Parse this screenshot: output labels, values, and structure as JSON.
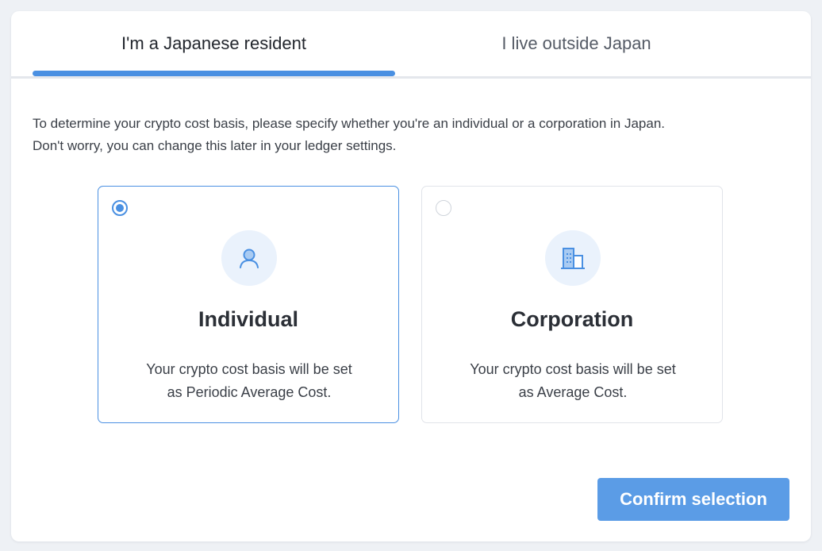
{
  "tabs": [
    {
      "label": "I'm a Japanese resident",
      "active": true
    },
    {
      "label": "I live outside Japan",
      "active": false
    }
  ],
  "intro": {
    "line1": "To determine your crypto cost basis, please specify whether you're an individual or a corporation in Japan.",
    "line2": "Don't worry, you can change this later in your ledger settings."
  },
  "options": [
    {
      "title": "Individual",
      "desc_line1": "Your crypto cost basis will be set",
      "desc_line2": "as Periodic Average Cost.",
      "selected": true,
      "icon": "person-icon"
    },
    {
      "title": "Corporation",
      "desc_line1": "Your crypto cost basis will be set",
      "desc_line2": "as Average Cost.",
      "selected": false,
      "icon": "building-icon"
    }
  ],
  "confirm_label": "Confirm selection",
  "colors": {
    "accent": "#4a90e2",
    "button": "#5b9ce6",
    "icon_bg": "#eaf2fc",
    "page_bg": "#eef1f5"
  }
}
